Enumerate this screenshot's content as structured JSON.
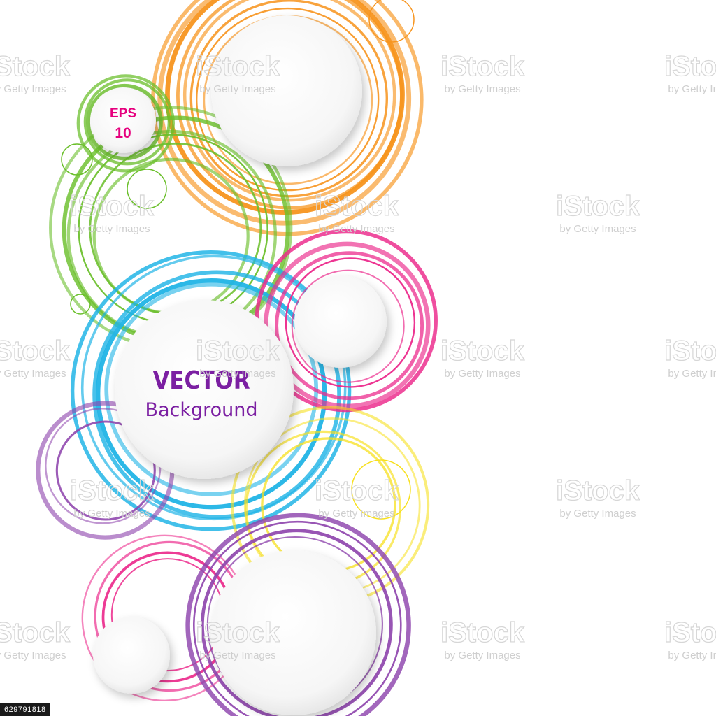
{
  "eps": {
    "line1": "EPS",
    "line2": "10"
  },
  "headline": {
    "title": "VECTOR",
    "subtitle": "Background"
  },
  "watermark": {
    "brand": "iStock",
    "credit": "by Getty Images"
  },
  "stock_id": "629791818",
  "colors": {
    "orange": "#f7941d",
    "green": "#6abf2a",
    "blue": "#1fb4e6",
    "pink": "#ec2a8c",
    "purple": "#8e44ad",
    "yellow": "#f7e01d",
    "text_purple": "#7b1fa2",
    "eps_pink": "#e6007e"
  }
}
